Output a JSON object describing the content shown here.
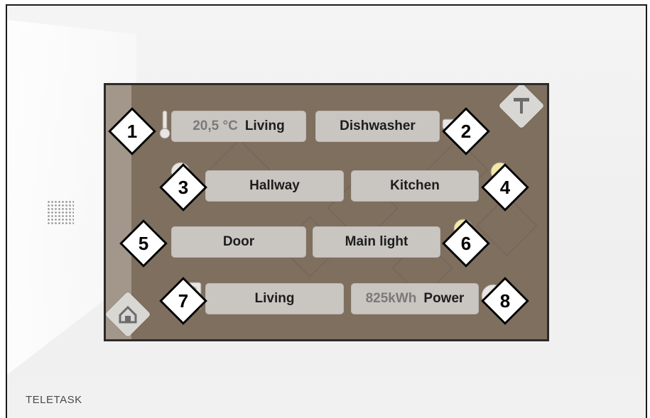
{
  "brand": "TELETASK",
  "buttons": [
    {
      "id": "1",
      "value": "20,5 °C",
      "label": "Living"
    },
    {
      "id": "2",
      "value": "",
      "label": "Dishwasher"
    },
    {
      "id": "3",
      "value": "",
      "label": "Hallway"
    },
    {
      "id": "4",
      "value": "",
      "label": "Kitchen"
    },
    {
      "id": "5",
      "value": "",
      "label": "Door"
    },
    {
      "id": "6",
      "value": "",
      "label": "Main light"
    },
    {
      "id": "7",
      "value": "",
      "label": "Living"
    },
    {
      "id": "8",
      "value": "825kWh",
      "label": "Power"
    }
  ],
  "callouts": [
    "1",
    "2",
    "3",
    "4",
    "5",
    "6",
    "7",
    "8"
  ],
  "icons": {
    "home": "home-icon",
    "cleaning": "squeegee-icon",
    "b1": "thermometer-icon",
    "b2": "plug-icon",
    "b3": "bulb-icon",
    "b4": "bulb-icon",
    "b5": "door-lock-icon",
    "b6": "bulb-icon",
    "b7": "speaker-icon",
    "b8": "power-meter-icon"
  },
  "colors": {
    "screen_bg": "#7f6f5e",
    "button_bg": "#c9c6c2",
    "value_text": "#7a7a7a",
    "active_glow": "#f3e8a6"
  }
}
